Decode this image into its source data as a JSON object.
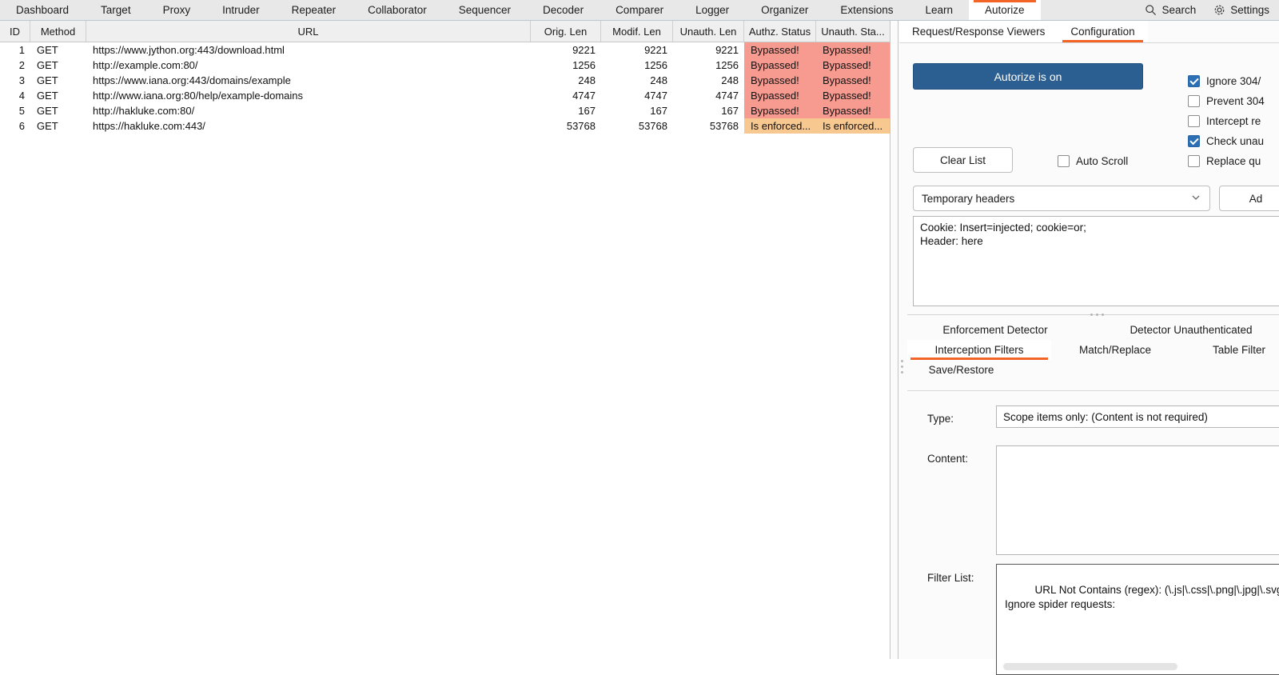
{
  "topbar": {
    "tabs": [
      {
        "label": "Dashboard",
        "active": false
      },
      {
        "label": "Target",
        "active": false
      },
      {
        "label": "Proxy",
        "active": false
      },
      {
        "label": "Intruder",
        "active": false
      },
      {
        "label": "Repeater",
        "active": false
      },
      {
        "label": "Collaborator",
        "active": false
      },
      {
        "label": "Sequencer",
        "active": false
      },
      {
        "label": "Decoder",
        "active": false
      },
      {
        "label": "Comparer",
        "active": false
      },
      {
        "label": "Logger",
        "active": false
      },
      {
        "label": "Organizer",
        "active": false
      },
      {
        "label": "Extensions",
        "active": false
      },
      {
        "label": "Learn",
        "active": false
      },
      {
        "label": "Autorize",
        "active": true
      }
    ],
    "search_label": "Search",
    "settings_label": "Settings",
    "search_icon": "search-icon",
    "settings_icon": "gear-icon",
    "accent_color": "#f26526"
  },
  "table": {
    "columns": [
      "ID",
      "Method",
      "URL",
      "Orig. Len",
      "Modif. Len",
      "Unauth. Len",
      "Authz. Status",
      "Unauth. Sta..."
    ],
    "rows": [
      {
        "id": "1",
        "method": "GET",
        "url": "https://www.jython.org:443/download.html",
        "orig_len": "9221",
        "modif_len": "9221",
        "unauth_len": "9221",
        "authz_status": "Bypassed!",
        "unauth_status": "Bypassed!",
        "status_class": "bypassed"
      },
      {
        "id": "2",
        "method": "GET",
        "url": "http://example.com:80/",
        "orig_len": "1256",
        "modif_len": "1256",
        "unauth_len": "1256",
        "authz_status": "Bypassed!",
        "unauth_status": "Bypassed!",
        "status_class": "bypassed"
      },
      {
        "id": "3",
        "method": "GET",
        "url": "https://www.iana.org:443/domains/example",
        "orig_len": "248",
        "modif_len": "248",
        "unauth_len": "248",
        "authz_status": "Bypassed!",
        "unauth_status": "Bypassed!",
        "status_class": "bypassed"
      },
      {
        "id": "4",
        "method": "GET",
        "url": "http://www.iana.org:80/help/example-domains",
        "orig_len": "4747",
        "modif_len": "4747",
        "unauth_len": "4747",
        "authz_status": "Bypassed!",
        "unauth_status": "Bypassed!",
        "status_class": "bypassed"
      },
      {
        "id": "5",
        "method": "GET",
        "url": "http://hakluke.com:80/",
        "orig_len": "167",
        "modif_len": "167",
        "unauth_len": "167",
        "authz_status": "Bypassed!",
        "unauth_status": "Bypassed!",
        "status_class": "bypassed"
      },
      {
        "id": "6",
        "method": "GET",
        "url": "https://hakluke.com:443/",
        "orig_len": "53768",
        "modif_len": "53768",
        "unauth_len": "53768",
        "authz_status": "Is enforced...",
        "unauth_status": "Is enforced...",
        "status_class": "enforced"
      }
    ],
    "status_colors": {
      "bypassed": "#f79a90",
      "enforced": "#f8c891"
    }
  },
  "config": {
    "subtabs": [
      {
        "label": "Request/Response Viewers",
        "active": false
      },
      {
        "label": "Configuration",
        "active": true
      }
    ],
    "autorize_button": "Autorize is on",
    "clear_list_button": "Clear List",
    "auto_scroll_label": "Auto Scroll",
    "auto_scroll_checked": false,
    "checkboxes": [
      {
        "label": "Ignore 304/",
        "checked": true
      },
      {
        "label": "Prevent 304",
        "checked": false
      },
      {
        "label": "Intercept re",
        "checked": false
      },
      {
        "label": "Check unau",
        "checked": true
      },
      {
        "label": "Replace qu",
        "checked": false
      }
    ],
    "headers_select": "Temporary headers",
    "add_button": "Ad",
    "headers_text": "Cookie: Insert=injected; cookie=or;\nHeader: here",
    "filter_tabs_row1": [
      {
        "label": "Enforcement Detector",
        "active": false
      },
      {
        "label": "Detector Unauthenticated",
        "active": false
      }
    ],
    "filter_tabs_row2": [
      {
        "label": "Interception Filters",
        "active": true
      },
      {
        "label": "Match/Replace",
        "active": false
      },
      {
        "label": "Table Filter",
        "active": false
      }
    ],
    "filter_tabs_row3": [
      {
        "label": "Save/Restore",
        "active": false
      }
    ],
    "type_label": "Type:",
    "type_value": "Scope items only: (Content is not required)",
    "content_label": "Content:",
    "content_value": "",
    "filter_list_label": "Filter List:",
    "filter_list_value": "URL Not Contains (regex): (\\.js|\\.css|\\.png|\\.jpg|\\.svg|\\.jp\nIgnore spider requests:",
    "primary_color": "#2c5f91"
  }
}
